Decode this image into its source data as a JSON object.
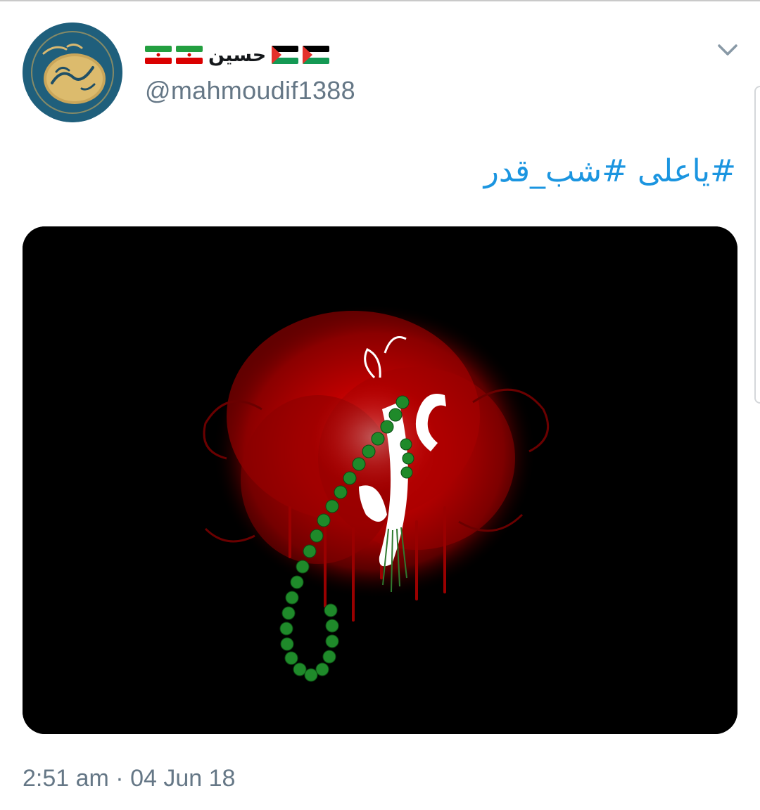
{
  "tweet": {
    "display_name": "حسین",
    "handle": "@mahmoudif1388",
    "text": "#یاعلی #شب_قدر",
    "time": "2:51 am",
    "separator": " · ",
    "date": "04 Jun 18"
  },
  "icons": {
    "menu": "chevron-down-icon",
    "flags": [
      "palestine-flag",
      "palestine-flag",
      "iran-flag",
      "iran-flag"
    ]
  },
  "colors": {
    "link": "#1b95e0",
    "secondary_text": "#657786",
    "primary_text": "#14171a"
  }
}
